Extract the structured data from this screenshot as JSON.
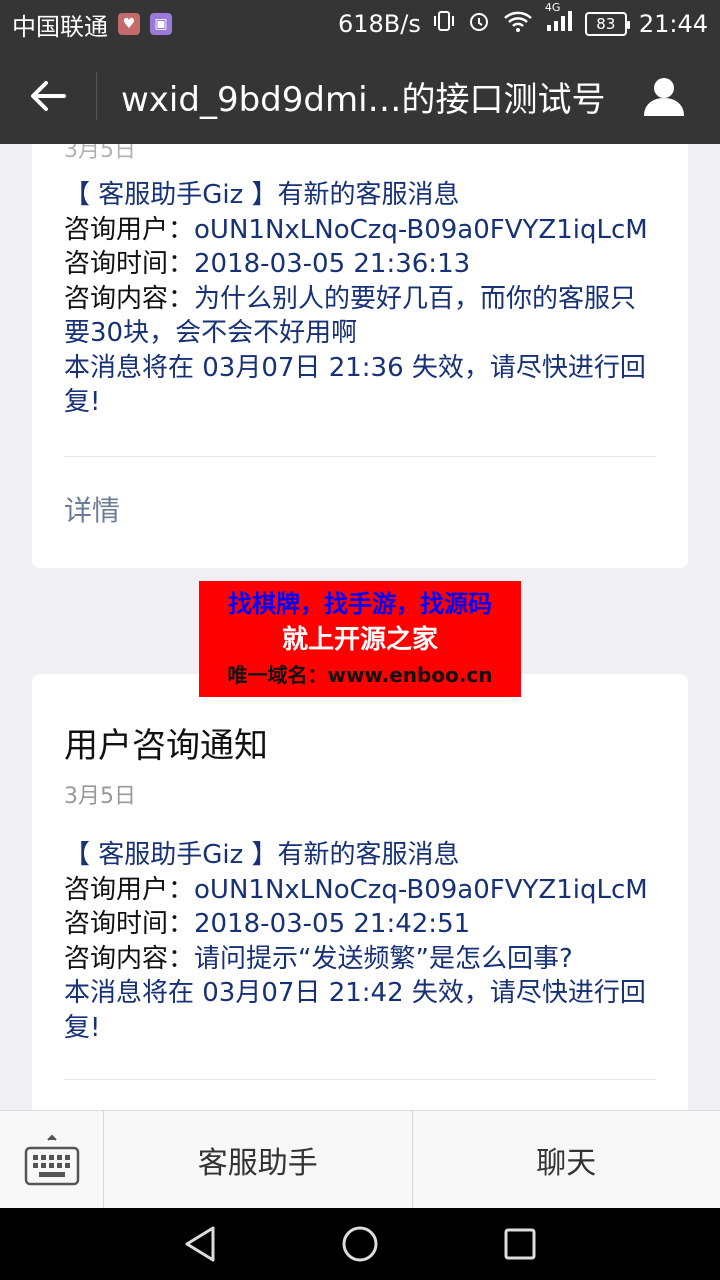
{
  "status_bar": {
    "carrier": "中国联通",
    "net_speed": "618B/s",
    "network_type": "4G",
    "battery": "83",
    "time": "21:44"
  },
  "header": {
    "title": "wxid_9bd9dmi…的接口测试号"
  },
  "cards": [
    {
      "date_cut": "3月5日",
      "header": "【 客服助手Giz 】有新的客服消息",
      "user_label": "咨询用户：",
      "user": "oUN1NxLNoCzq-B09a0FVYZ1iqLcM",
      "time_label": "咨询时间：",
      "time": "2018-03-05 21:36:13",
      "content_label": "咨询内容：",
      "content": "为什么别人的要好几百，而你的客服只要30块，会不会不好用啊",
      "expire": "本消息将在 03月07日 21:36 失效，请尽快进行回复!",
      "detail": "详情"
    },
    {
      "title": "用户咨询通知",
      "date": "3月5日",
      "header": "【 客服助手Giz 】有新的客服消息",
      "user_label": "咨询用户：",
      "user": "oUN1NxLNoCzq-B09a0FVYZ1iqLcM",
      "time_label": "咨询时间：",
      "time": "2018-03-05 21:42:51",
      "content_label": "咨询内容：",
      "content": "请问提示“发送频繁”是怎么回事?",
      "expire": "本消息将在 03月07日 21:42 失效，请尽快进行回复!"
    }
  ],
  "ad": {
    "line1": "找棋牌，找手游，找源码",
    "line2": "就上开源之家",
    "line3": "唯一域名：www.enboo.cn"
  },
  "bottom_menu": {
    "items": [
      "客服助手",
      "聊天"
    ]
  },
  "colors": {
    "header_bg": "#353535",
    "link_blue": "#173177",
    "detail_gray": "#6b7c97",
    "ad_red": "#ff0000"
  }
}
